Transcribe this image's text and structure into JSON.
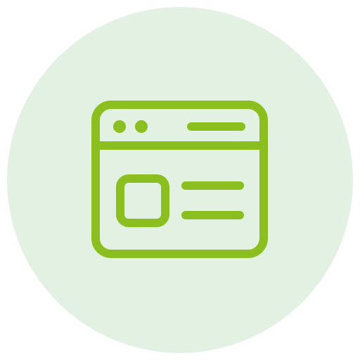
{
  "icon": {
    "name": "browser-window-icon",
    "color": "#8bbf1f",
    "background_color": "#e3f1e3"
  }
}
